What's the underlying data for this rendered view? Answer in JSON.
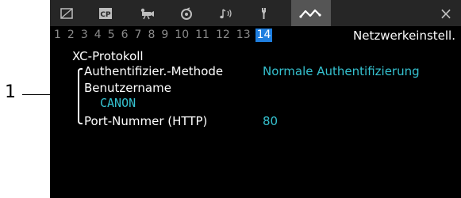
{
  "callout": {
    "number": "1"
  },
  "tabs": [
    {
      "icon": "camera-frame-icon",
      "active": false
    },
    {
      "icon": "cp-icon",
      "label": "CP",
      "active": false
    },
    {
      "icon": "movie-camera-icon",
      "active": false
    },
    {
      "icon": "dial-icon",
      "active": false
    },
    {
      "icon": "audio-icon",
      "active": false
    },
    {
      "icon": "wrench-icon",
      "active": false
    },
    {
      "icon": "custom-function-icon",
      "active": false
    },
    {
      "icon": "network-icon",
      "active": true
    }
  ],
  "close": {
    "icon": "close-icon",
    "glyph": "×"
  },
  "pages": {
    "numbers": [
      "1",
      "2",
      "3",
      "4",
      "5",
      "6",
      "7",
      "8",
      "9",
      "10",
      "11",
      "12",
      "13",
      "14"
    ],
    "current": "14"
  },
  "section_title": "Netzwerkeinstell.",
  "settings": {
    "protocol_title": "XC-Protokoll",
    "auth_method_label": "Authentifizier.-Methode",
    "auth_method_value": "Normale Authentifizierung",
    "username_label": "Benutzername",
    "username_value": "CANON",
    "port_label": "Port-Nummer (HTTP)",
    "port_value": "80"
  },
  "colors": {
    "background": "#000000",
    "tabbar": "#262626",
    "active_tab": "#555555",
    "current_page": "#1f7fe0",
    "value_text": "#35c1cf"
  }
}
